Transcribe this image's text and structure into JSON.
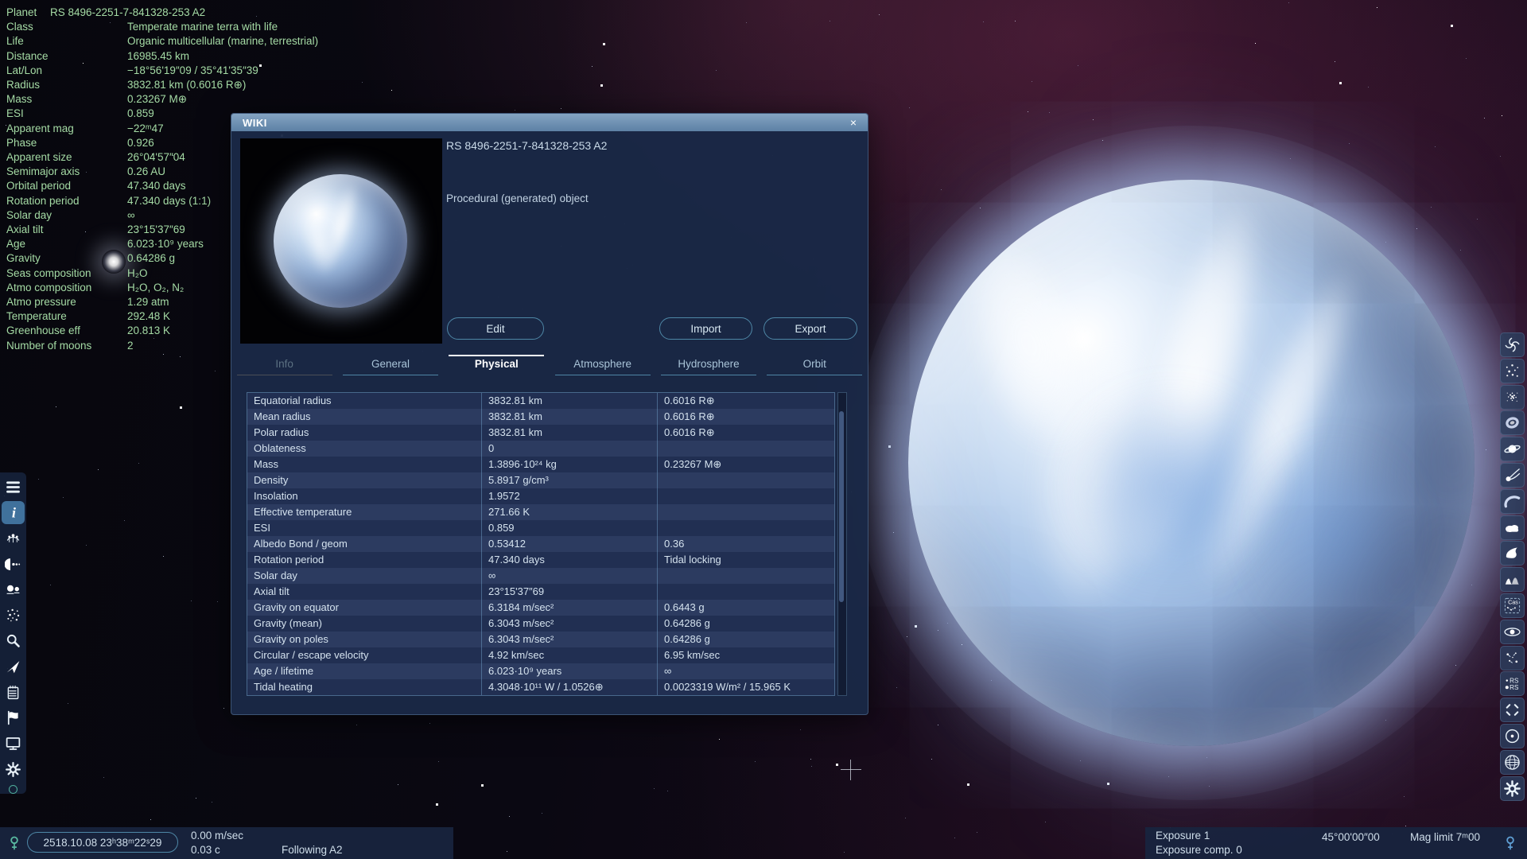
{
  "colors": {
    "info_text": "#a5dba5",
    "titlebar": "#7b9cba",
    "accent_border": "#4e87a6",
    "window_bg": "#1a2846",
    "active_tile": "#40719c"
  },
  "info_panel": {
    "rows": [
      {
        "label": "Planet",
        "value": "RS 8496-2251-7-841328-253 A2"
      },
      {
        "label": "Class",
        "value": "Temperate marine terra with life"
      },
      {
        "label": "Life",
        "value": "Organic multicellular (marine, terrestrial)"
      },
      {
        "label": "Distance",
        "value": "16985.45 km"
      },
      {
        "label": "Lat/Lon",
        "value": "−18°56'19″09 / 35°41'35″39"
      },
      {
        "label": "Radius",
        "value": "3832.81 km (0.6016 R⊕)"
      },
      {
        "label": "Mass",
        "value": "0.23267 M⊕"
      },
      {
        "label": "ESI",
        "value": "0.859"
      },
      {
        "label": "Apparent mag",
        "value": "−22ᵐ47"
      },
      {
        "label": "Phase",
        "value": "0.926"
      },
      {
        "label": "Apparent size",
        "value": "26°04'57″04"
      },
      {
        "label": "Semimajor axis",
        "value": "0.26 AU"
      },
      {
        "label": "Orbital period",
        "value": "47.340 days"
      },
      {
        "label": "Rotation period",
        "value": "47.340 days (1:1)"
      },
      {
        "label": "Solar day",
        "value": "∞"
      },
      {
        "label": "Axial tilt",
        "value": "23°15'37″69"
      },
      {
        "label": "Age",
        "value": "6.023·10⁹ years"
      },
      {
        "label": "Gravity",
        "value": "0.64286 g"
      },
      {
        "label": "Seas composition",
        "value": "H₂O"
      },
      {
        "label": "Atmo composition",
        "value": "H₂O, O₂, N₂"
      },
      {
        "label": "Atmo pressure",
        "value": "1.29 atm"
      },
      {
        "label": "Temperature",
        "value": "292.48 K"
      },
      {
        "label": "Greenhouse eff",
        "value": "20.813 K"
      },
      {
        "label": "Number of moons",
        "value": "2"
      }
    ]
  },
  "wiki": {
    "title": "WIKI",
    "close_label": "×",
    "object_name": "RS 8496-2251-7-841328-253 A2",
    "object_type": "Procedural (generated) object",
    "buttons": [
      "Edit",
      "Import",
      "Export"
    ],
    "tabs": [
      {
        "label": "Info",
        "state": "disabled"
      },
      {
        "label": "General",
        "state": "normal"
      },
      {
        "label": "Physical",
        "state": "active"
      },
      {
        "label": "Atmosphere",
        "state": "normal"
      },
      {
        "label": "Hydrosphere",
        "state": "normal"
      },
      {
        "label": "Orbit",
        "state": "normal"
      }
    ],
    "table": [
      [
        "Equatorial radius",
        "3832.81 km",
        "0.6016 R⊕"
      ],
      [
        "Mean radius",
        "3832.81 km",
        "0.6016 R⊕"
      ],
      [
        "Polar radius",
        "3832.81 km",
        "0.6016 R⊕"
      ],
      [
        "Oblateness",
        "0",
        ""
      ],
      [
        "Mass",
        "1.3896·10²⁴ kg",
        "0.23267 M⊕"
      ],
      [
        "Density",
        "5.8917 g/cm³",
        ""
      ],
      [
        "Insolation",
        "1.9572",
        ""
      ],
      [
        "Effective temperature",
        "271.66 K",
        ""
      ],
      [
        "ESI",
        "0.859",
        ""
      ],
      [
        "Albedo Bond / geom",
        "0.53412",
        "0.36"
      ],
      [
        "Rotation period",
        "47.340 days",
        "Tidal locking"
      ],
      [
        "Solar day",
        "∞",
        ""
      ],
      [
        "Axial tilt",
        "23°15'37″69",
        ""
      ],
      [
        "Gravity on equator",
        "6.3184 m/sec²",
        "0.6443 g"
      ],
      [
        "Gravity (mean)",
        "6.3043 m/sec²",
        "0.64286 g"
      ],
      [
        "Gravity on poles",
        "6.3043 m/sec²",
        "0.64286 g"
      ],
      [
        "Circular / escape velocity",
        "4.92 km/sec",
        "6.95 km/sec"
      ],
      [
        "Age / lifetime",
        "6.023·10⁹ years",
        "∞"
      ],
      [
        "Tidal heating",
        "4.3048·10¹¹ W / 1.0526⊕",
        "0.0023319 W/m² / 15.965 K"
      ]
    ]
  },
  "status_bar_left": {
    "date": "2518.10.08 23ʰ38ᵐ22ˢ29",
    "speed": "0.00 m/sec",
    "speed_c": "0.03 c",
    "following": "Following A2"
  },
  "status_bar_right": {
    "exposure": "Exposure 1",
    "exposure_comp": "Exposure comp. 0",
    "fov": "45°00'00″00",
    "mag_limit": "Mag limit 7ᵐ00"
  },
  "left_toolbar": {
    "icons": [
      {
        "name": "menu-icon",
        "active": false
      },
      {
        "name": "info-icon",
        "active": true
      },
      {
        "name": "system-browser-icon",
        "active": false
      },
      {
        "name": "planet-browser-icon",
        "active": false
      },
      {
        "name": "binary-stars-icon",
        "active": false
      },
      {
        "name": "star-field-icon",
        "active": false
      },
      {
        "name": "search-icon",
        "active": false
      },
      {
        "name": "spacecraft-icon",
        "active": false
      },
      {
        "name": "journal-icon",
        "active": false
      },
      {
        "name": "flag-icon",
        "active": false
      },
      {
        "name": "display-icon",
        "active": false
      },
      {
        "name": "settings-gear-icon",
        "active": false
      }
    ]
  },
  "right_toolbar": {
    "icons": [
      {
        "name": "galaxies-icon"
      },
      {
        "name": "stars-icon"
      },
      {
        "name": "star-clusters-icon"
      },
      {
        "name": "nebulae-icon"
      },
      {
        "name": "planets-icon"
      },
      {
        "name": "comets-icon"
      },
      {
        "name": "atmospheres-icon"
      },
      {
        "name": "clouds-icon"
      },
      {
        "name": "water-icon"
      },
      {
        "name": "landscapes-icon"
      },
      {
        "name": "constellations-icon"
      },
      {
        "name": "eclipses-icon"
      },
      {
        "name": "labels-icon"
      },
      {
        "name": "catalog-names-icon"
      },
      {
        "name": "markers-icon"
      },
      {
        "name": "orbits-icon"
      },
      {
        "name": "grid-icon"
      },
      {
        "name": "settings-gear-icon"
      }
    ]
  }
}
